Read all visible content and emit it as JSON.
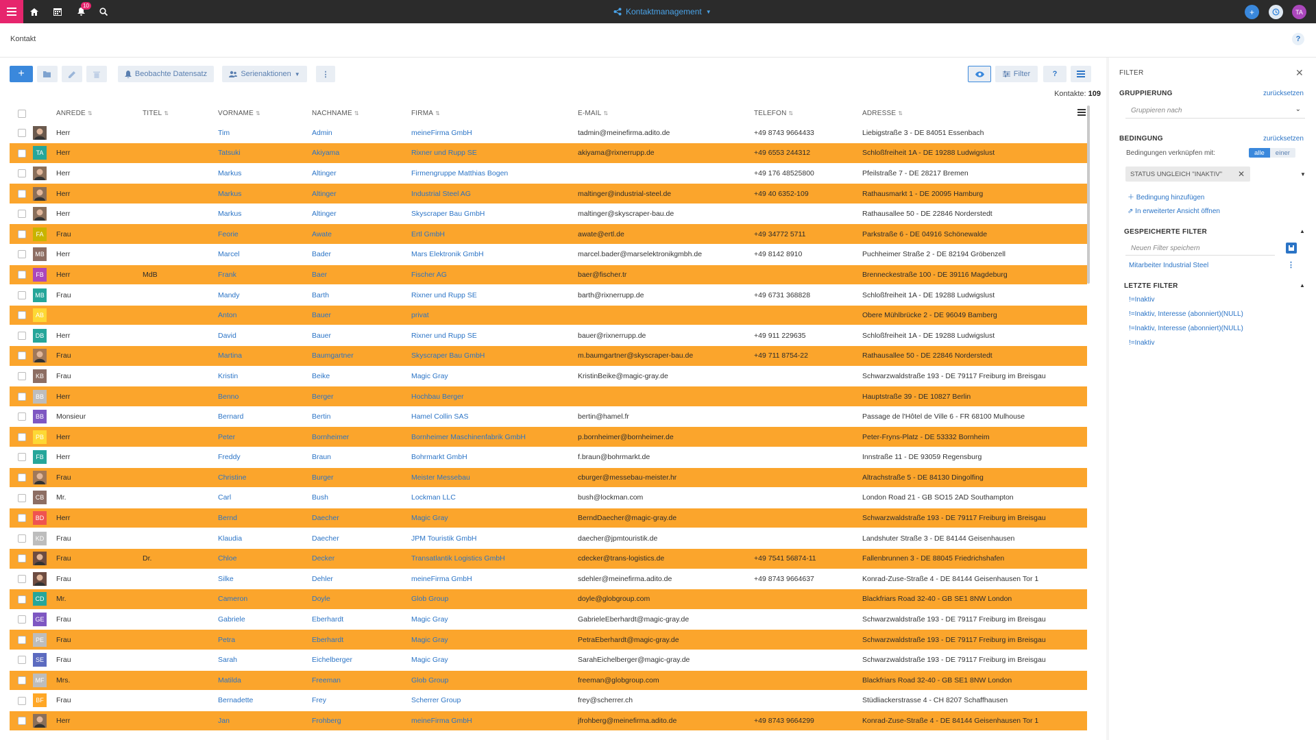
{
  "app": {
    "title": "Kontaktmanagement",
    "notifications": "10",
    "avatar": "TA"
  },
  "breadcrumb": "Kontakt",
  "toolbar": {
    "watch": "Beobachte Datensatz",
    "series": "Serienaktionen",
    "filter": "Filter",
    "count_label": "Kontakte:",
    "count": "109"
  },
  "columns": [
    "ANREDE",
    "TITEL",
    "VORNAME",
    "NACHNAME",
    "FIRMA",
    "E-MAIL",
    "TELEFON",
    "ADRESSE"
  ],
  "rows": [
    {
      "ini": "",
      "col": "#6b5a4e",
      "photo": true,
      "anrede": "Herr",
      "titel": "",
      "vorname": "Tim",
      "nachname": "Admin",
      "firma": "meineFirma GmbH",
      "email": "tadmin@meinefirma.adito.de",
      "tel": "+49 8743 9664433",
      "adresse": "Liebigstraße 3 - DE 84051 Essenbach"
    },
    {
      "ini": "TA",
      "col": "#26a69a",
      "photo": false,
      "anrede": "Herr",
      "titel": "",
      "vorname": "Tatsuki",
      "nachname": "Akiyama",
      "firma": "Rixner und Rupp SE",
      "email": "akiyama@rixnerrupp.de",
      "tel": "+49 6553 244312",
      "adresse": "Schloßfreiheit 1A - DE 19288 Ludwigslust"
    },
    {
      "ini": "",
      "col": "#8a6f5a",
      "photo": true,
      "anrede": "Herr",
      "titel": "",
      "vorname": "Markus",
      "nachname": "Altinger",
      "firma": "Firmengruppe Matthias Bogen",
      "email": "",
      "tel": "+49 176 48525800",
      "adresse": "Pfeilstraße 7 - DE 28217 Bremen"
    },
    {
      "ini": "",
      "col": "#8a6f5a",
      "photo": true,
      "anrede": "Herr",
      "titel": "",
      "vorname": "Markus",
      "nachname": "Altinger",
      "firma": "Industrial Steel AG",
      "email": "maltinger@industrial-steel.de",
      "tel": "+49 40 6352-109",
      "adresse": "Rathausmarkt 1 - DE 20095 Hamburg"
    },
    {
      "ini": "",
      "col": "#8a6f5a",
      "photo": true,
      "anrede": "Herr",
      "titel": "",
      "vorname": "Markus",
      "nachname": "Altinger",
      "firma": "Skyscraper Bau GmbH",
      "email": "maltinger@skyscraper-bau.de",
      "tel": "",
      "adresse": "Rathausallee 50 - DE 22846 Norderstedt"
    },
    {
      "ini": "FA",
      "col": "#c8b400",
      "photo": false,
      "anrede": "Frau",
      "titel": "",
      "vorname": "Feorie",
      "nachname": "Awate",
      "firma": "Ertl GmbH",
      "email": "awate@ertl.de",
      "tel": "+49 34772 5711",
      "adresse": "Parkstraße 6 - DE 04916 Schönewalde"
    },
    {
      "ini": "MB",
      "col": "#8d6e63",
      "photo": false,
      "anrede": "Herr",
      "titel": "",
      "vorname": "Marcel",
      "nachname": "Bader",
      "firma": "Mars Elektronik GmbH",
      "email": "marcel.bader@marselektronikgmbh.de",
      "tel": "+49 8142 8910",
      "adresse": "Puchheimer Straße 2 - DE 82194 Gröbenzell"
    },
    {
      "ini": "FB",
      "col": "#ab47bc",
      "photo": false,
      "anrede": "Herr",
      "titel": "MdB",
      "vorname": "Frank",
      "nachname": "Baer",
      "firma": "Fischer AG",
      "email": "baer@fischer.tr",
      "tel": "",
      "adresse": "Brenneckestraße 100 - DE 39116 Magdeburg"
    },
    {
      "ini": "MB",
      "col": "#26a69a",
      "photo": false,
      "anrede": "Frau",
      "titel": "",
      "vorname": "Mandy",
      "nachname": "Barth",
      "firma": "Rixner und Rupp SE",
      "email": "barth@rixnerrupp.de",
      "tel": "+49 6731 368828",
      "adresse": "Schloßfreiheit 1A - DE 19288 Ludwigslust"
    },
    {
      "ini": "AB",
      "col": "#fdd835",
      "photo": false,
      "anrede": "",
      "titel": "",
      "vorname": "Anton",
      "nachname": "Bauer",
      "firma": "privat",
      "email": "",
      "tel": "",
      "adresse": "Obere Mühlbrücke 2 - DE 96049 Bamberg"
    },
    {
      "ini": "DB",
      "col": "#26a69a",
      "photo": false,
      "anrede": "Herr",
      "titel": "",
      "vorname": "David",
      "nachname": "Bauer",
      "firma": "Rixner und Rupp SE",
      "email": "bauer@rixnerrupp.de",
      "tel": "+49 911 229635",
      "adresse": "Schloßfreiheit 1A - DE 19288 Ludwigslust"
    },
    {
      "ini": "",
      "col": "#a0785a",
      "photo": true,
      "anrede": "Frau",
      "titel": "",
      "vorname": "Martina",
      "nachname": "Baumgartner",
      "firma": "Skyscraper Bau GmbH",
      "email": "m.baumgartner@skyscraper-bau.de",
      "tel": "+49 711 8754-22",
      "adresse": "Rathausallee 50 - DE 22846 Norderstedt"
    },
    {
      "ini": "KB",
      "col": "#8d6e63",
      "photo": false,
      "anrede": "Frau",
      "titel": "",
      "vorname": "Kristin",
      "nachname": "Beike",
      "firma": "Magic Gray",
      "email": "KristinBeike@magic-gray.de",
      "tel": "",
      "adresse": "Schwarzwaldstraße 193 - DE 79117 Freiburg im Breisgau"
    },
    {
      "ini": "BB",
      "col": "#bdbdbd",
      "photo": false,
      "anrede": "Herr",
      "titel": "",
      "vorname": "Benno",
      "nachname": "Berger",
      "firma": "Hochbau Berger",
      "email": "",
      "tel": "",
      "adresse": "Hauptstraße 39 - DE 10827 Berlin"
    },
    {
      "ini": "BB",
      "col": "#7e57c2",
      "photo": false,
      "anrede": "Monsieur",
      "titel": "",
      "vorname": "Bernard",
      "nachname": "Bertin",
      "firma": "Hamel Collin SAS",
      "email": "bertin@hamel.fr",
      "tel": "",
      "adresse": "Passage de l'Hôtel de Ville 6 - FR 68100 Mulhouse"
    },
    {
      "ini": "PB",
      "col": "#fdd835",
      "photo": false,
      "anrede": "Herr",
      "titel": "",
      "vorname": "Peter",
      "nachname": "Bornheimer",
      "firma": "Bornheimer Maschinenfabrik GmbH",
      "email": "p.bornheimer@bornheimer.de",
      "tel": "",
      "adresse": "Peter-Fryns-Platz - DE 53332 Bornheim"
    },
    {
      "ini": "FB",
      "col": "#26a69a",
      "photo": false,
      "anrede": "Herr",
      "titel": "",
      "vorname": "Freddy",
      "nachname": "Braun",
      "firma": "Bohrmarkt GmbH",
      "email": "f.braun@bohrmarkt.de",
      "tel": "",
      "adresse": "Innstraße 11 - DE 93059 Regensburg"
    },
    {
      "ini": "",
      "col": "#a0785a",
      "photo": true,
      "anrede": "Frau",
      "titel": "",
      "vorname": "Christine",
      "nachname": "Burger",
      "firma": "Meister Messebau",
      "email": "cburger@messebau-meister.hr",
      "tel": "",
      "adresse": "Altrachstraße 5 - DE 84130 Dingolfing"
    },
    {
      "ini": "CB",
      "col": "#8d6e63",
      "photo": false,
      "anrede": "Mr.",
      "titel": "",
      "vorname": "Carl",
      "nachname": "Bush",
      "firma": "Lockman LLC",
      "email": "bush@lockman.com",
      "tel": "",
      "adresse": "London Road 21 - GB SO15 2AD Southampton"
    },
    {
      "ini": "BD",
      "col": "#ef5350",
      "photo": false,
      "anrede": "Herr",
      "titel": "",
      "vorname": "Bernd",
      "nachname": "Daecher",
      "firma": "Magic Gray",
      "email": "BerndDaecher@magic-gray.de",
      "tel": "",
      "adresse": "Schwarzwaldstraße 193 - DE 79117 Freiburg im Breisgau"
    },
    {
      "ini": "KD",
      "col": "#bdbdbd",
      "photo": false,
      "anrede": "Frau",
      "titel": "",
      "vorname": "Klaudia",
      "nachname": "Daecher",
      "firma": "JPM Touristik GmbH",
      "email": "daecher@jpmtouristik.de",
      "tel": "",
      "adresse": "Landshuter Straße 3 - DE 84144 Geisenhausen"
    },
    {
      "ini": "",
      "col": "#6d4c41",
      "photo": true,
      "anrede": "Frau",
      "titel": "Dr.",
      "vorname": "Chloe",
      "nachname": "Decker",
      "firma": "Transatlantik Logistics GmbH",
      "email": "cdecker@trans-logistics.de",
      "tel": "+49 7541 56874-11",
      "adresse": "Fallenbrunnen 3 - DE 88045 Friedrichshafen"
    },
    {
      "ini": "",
      "col": "#6d4c41",
      "photo": true,
      "anrede": "Frau",
      "titel": "",
      "vorname": "Silke",
      "nachname": "Dehler",
      "firma": "meineFirma GmbH",
      "email": "sdehler@meinefirma.adito.de",
      "tel": "+49 8743 9664637",
      "adresse": "Konrad-Zuse-Straße 4 - DE 84144 Geisenhausen Tor 1"
    },
    {
      "ini": "CD",
      "col": "#26a69a",
      "photo": false,
      "anrede": "Mr.",
      "titel": "",
      "vorname": "Cameron",
      "nachname": "Doyle",
      "firma": "Glob Group",
      "email": "doyle@globgroup.com",
      "tel": "",
      "adresse": "Blackfriars Road 32-40 - GB SE1 8NW London"
    },
    {
      "ini": "GE",
      "col": "#7e57c2",
      "photo": false,
      "anrede": "Frau",
      "titel": "",
      "vorname": "Gabriele",
      "nachname": "Eberhardt",
      "firma": "Magic Gray",
      "email": "GabrieleEberhardt@magic-gray.de",
      "tel": "",
      "adresse": "Schwarzwaldstraße 193 - DE 79117 Freiburg im Breisgau"
    },
    {
      "ini": "PE",
      "col": "#bdbdbd",
      "photo": false,
      "anrede": "Frau",
      "titel": "",
      "vorname": "Petra",
      "nachname": "Eberhardt",
      "firma": "Magic Gray",
      "email": "PetraEberhardt@magic-gray.de",
      "tel": "",
      "adresse": "Schwarzwaldstraße 193 - DE 79117 Freiburg im Breisgau"
    },
    {
      "ini": "SE",
      "col": "#5c6bc0",
      "photo": false,
      "anrede": "Frau",
      "titel": "",
      "vorname": "Sarah",
      "nachname": "Eichelberger",
      "firma": "Magic Gray",
      "email": "SarahEichelberger@magic-gray.de",
      "tel": "",
      "adresse": "Schwarzwaldstraße 193 - DE 79117 Freiburg im Breisgau"
    },
    {
      "ini": "MF",
      "col": "#bdbdbd",
      "photo": false,
      "anrede": "Mrs.",
      "titel": "",
      "vorname": "Matilda",
      "nachname": "Freeman",
      "firma": "Glob Group",
      "email": "freeman@globgroup.com",
      "tel": "",
      "adresse": "Blackfriars Road 32-40 - GB SE1 8NW London"
    },
    {
      "ini": "BF",
      "col": "#ffa726",
      "photo": false,
      "anrede": "Frau",
      "titel": "",
      "vorname": "Bernadette",
      "nachname": "Frey",
      "firma": "Scherrer Group",
      "email": "frey@scherrer.ch",
      "tel": "",
      "adresse": "Stüdliackerstrasse 4 - CH 8207 Schaffhausen"
    },
    {
      "ini": "",
      "col": "#8a6f5a",
      "photo": true,
      "anrede": "Herr",
      "titel": "",
      "vorname": "Jan",
      "nachname": "Frohberg",
      "firma": "meineFirma GmbH",
      "email": "jfrohberg@meinefirma.adito.de",
      "tel": "+49 8743 9664299",
      "adresse": "Konrad-Zuse-Straße 4 - DE 84144 Geisenhausen Tor 1"
    }
  ],
  "filter": {
    "title": "FILTER",
    "grouping": "GRUPPIERUNG",
    "reset": "zurücksetzen",
    "group_placeholder": "Gruppieren nach",
    "condition": "BEDINGUNG",
    "link_label": "Bedingungen verknüpfen mit:",
    "all": "alle",
    "one": "einer",
    "chip": "STATUS UNGLEICH \"INAKTIV\"",
    "add_condition": "Bedingung hinzufügen",
    "advanced": "In erweiterter Ansicht öffnen",
    "saved": "GESPEICHERTE FILTER",
    "save_placeholder": "Neuen Filter speichern",
    "saved_items": [
      "Mitarbeiter Industrial Steel"
    ],
    "recent": "LETZTE FILTER",
    "recent_items": [
      "!=Inaktiv",
      "!=Inaktiv, Interesse (abonniert)(NULL)",
      "!=Inaktiv, Interesse (abonniert)(NULL)",
      "!=Inaktiv"
    ]
  }
}
